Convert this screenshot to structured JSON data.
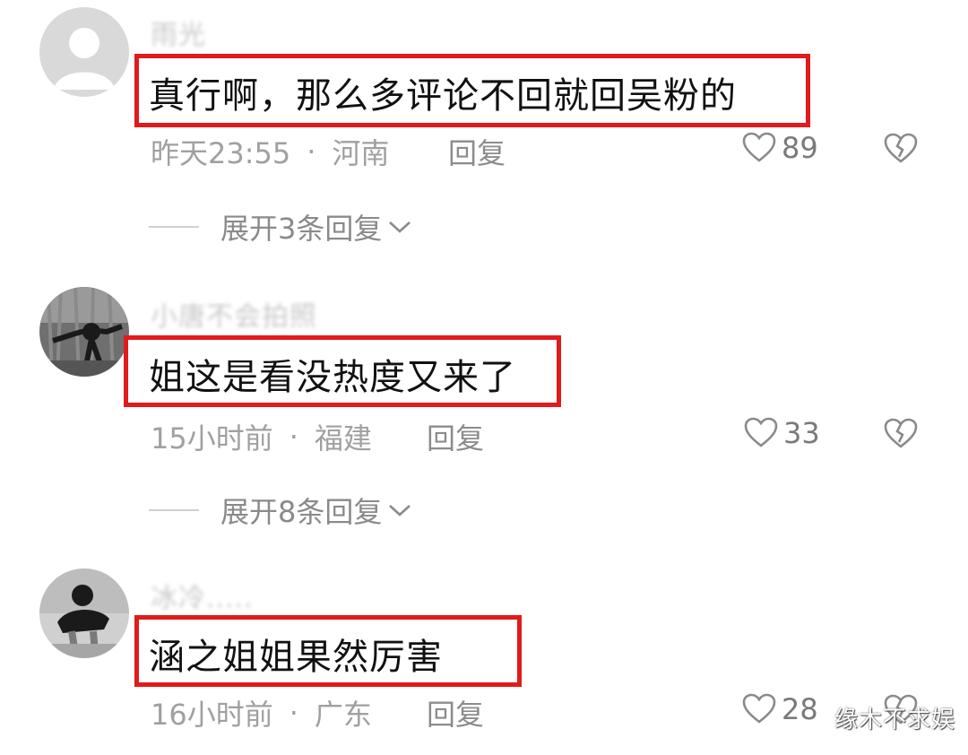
{
  "colors": {
    "highlight": "#e01b1b",
    "text": "#111111",
    "meta": "#a0a0a0"
  },
  "icons": {
    "like": "heart-outline-icon",
    "dislike": "broken-heart-icon",
    "expand": "chevron-down-icon"
  },
  "comments": [
    {
      "username": "雨光",
      "text": "真行啊，那么多评论不回就回吴粉的",
      "time": "昨天23:55",
      "location": "河南",
      "reply_label": "回复",
      "likes": "89",
      "expand_label": "展开3条回复"
    },
    {
      "username": "小唐不会拍照",
      "text": "姐这是看没热度又来了",
      "time": "15小时前",
      "location": "福建",
      "reply_label": "回复",
      "likes": "33",
      "expand_label": "展开8条回复"
    },
    {
      "username": "冰冷.....",
      "text": "涵之姐姐果然厉害",
      "time": "16小时前",
      "location": "广东",
      "reply_label": "回复",
      "likes": "28"
    }
  ],
  "separator": "·",
  "watermark": "缘木不求娱"
}
